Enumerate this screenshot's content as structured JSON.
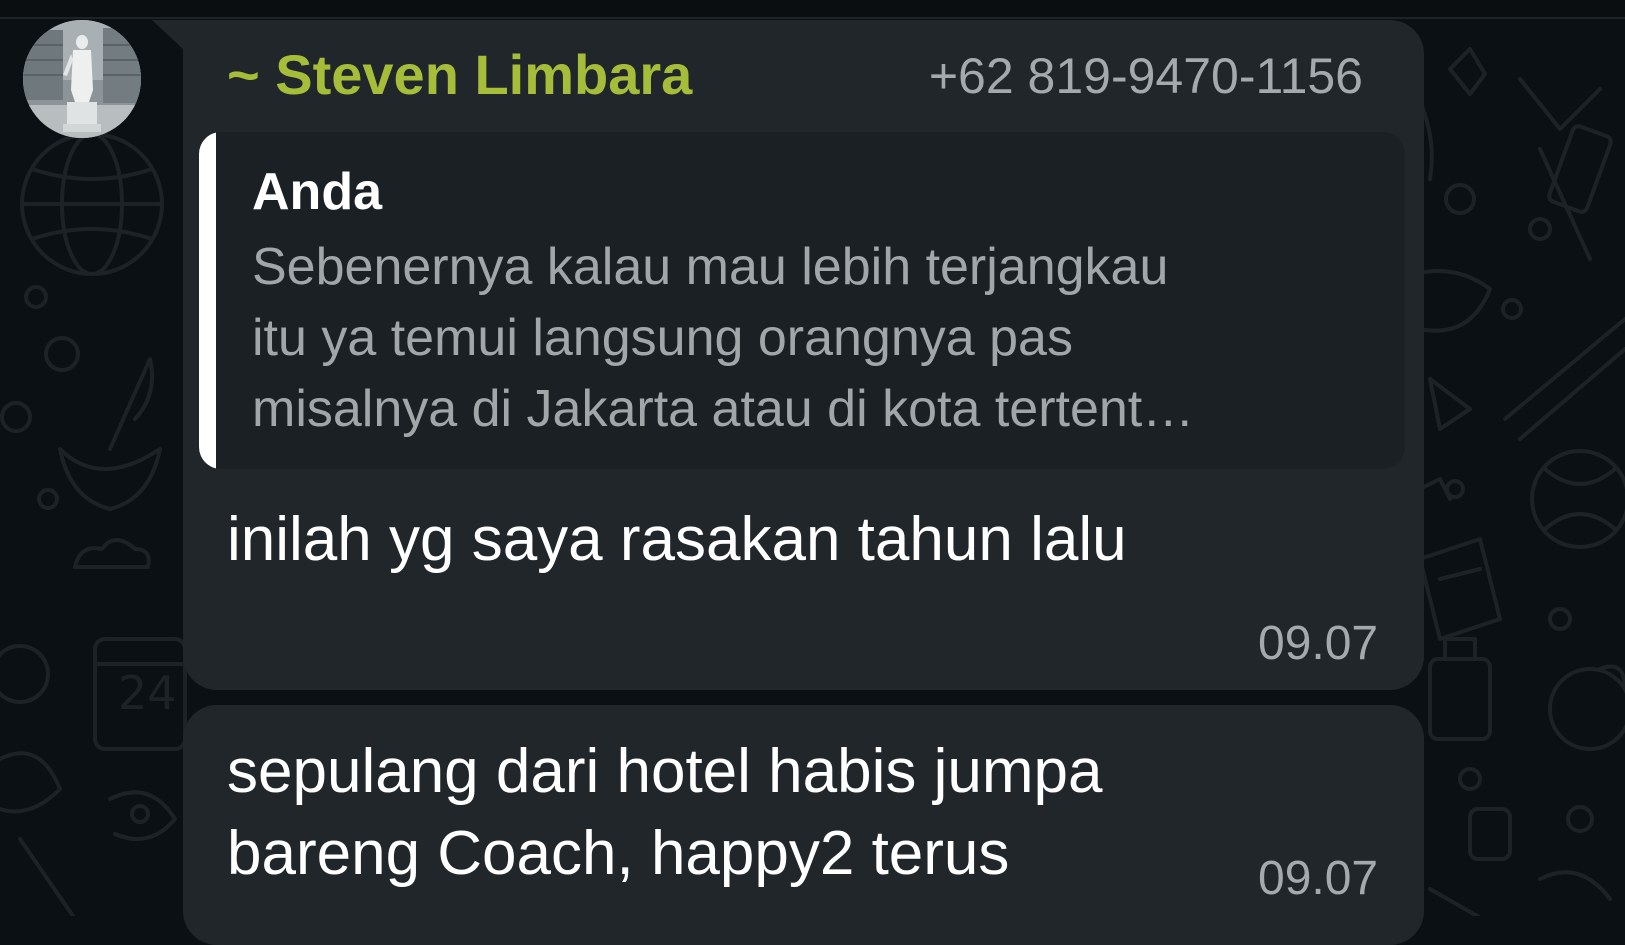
{
  "message_1": {
    "sender_name": "~ Steven Limbara",
    "sender_phone": "+62 819-9470-1156",
    "quoted": {
      "author": "Anda",
      "lines": [
        "Sebenernya kalau mau lebih terjangkau",
        "itu ya temui langsung orangnya pas",
        "misalnya di Jakarta atau di kota tertent…"
      ]
    },
    "text": "inilah yg saya rasakan tahun lalu",
    "time": "09.07"
  },
  "message_2": {
    "lines": [
      "sepulang dari hotel habis jumpa",
      "bareng Coach, happy2 terus"
    ],
    "time": "09.07"
  },
  "colors": {
    "background": "#0b1014",
    "bubble": "#21262a",
    "quote_background": "#1b2024",
    "sender_name": "#a6bd3a",
    "quote_text": "#a1a6a9",
    "meta_text": "#a4a9ad",
    "message_text": "#ffffff"
  },
  "icons": {
    "avatar": "statue-photo-avatar",
    "wallpaper": "doodle-pattern"
  }
}
